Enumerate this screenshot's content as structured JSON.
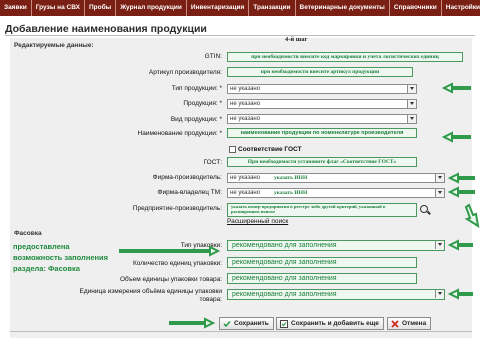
{
  "menu": {
    "items": [
      "Заявки",
      "Грузы на СВХ",
      "Пробы",
      "Журнал продукции",
      "Инвентаризация",
      "Транзакции",
      "Ветеринарные документы",
      "Справочники",
      "Настройки"
    ]
  },
  "page_title": "Добавление наименования продукции",
  "step_label": "4-й шаг",
  "sections": {
    "editable": "Редактируемые данные:",
    "packaging": "Фасовка"
  },
  "fields": {
    "gtin": {
      "label": "GTIN:",
      "hint": "при необходимости внесите код маркировки и учета логистических единиц"
    },
    "article": {
      "label": "Артикул производителя:",
      "hint": "при необходимости внесите артикул продукции"
    },
    "product_type": {
      "label": "Тип продукции: *",
      "value": "не указано"
    },
    "product": {
      "label": "Продукция: *",
      "value": "не указано"
    },
    "product_kind": {
      "label": "Вид продукции: *",
      "value": "не указано"
    },
    "product_name": {
      "label": "Наименование продукции: *",
      "hint": "наименование продукции по номенклатуре производителя"
    },
    "gost_checkbox": {
      "label": "Соответствие ГОСТ"
    },
    "gost": {
      "label": "ГОСТ:",
      "hint": "При необходимости установите флаг «Соответствие ГОСТ»"
    },
    "manufacturer": {
      "label": "Фирма-производитель:",
      "value": "не указано",
      "hint": "указать ИНН"
    },
    "tm_owner": {
      "label": "Фирма-владелец ТМ:",
      "value": "не указано",
      "hint": "указать ИНН"
    },
    "enterprise": {
      "label": "Предприятие-производитель:",
      "hint": "указать номер предприятия в реестре либо другой критерий, указанный в расширенном поиске"
    },
    "advanced_search": "Расширенный поиск"
  },
  "packaging": {
    "side_note": "предоставлена возможность заполнения раздела: Фасовка",
    "package_type": {
      "label": "Тип упаковки:",
      "hint": "рекомендовано для заполнения"
    },
    "package_count": {
      "label": "Количество единиц упаковки:",
      "hint": "рекомендовано для заполнения"
    },
    "package_volume": {
      "label": "Объем единицы упаковки товара:",
      "hint": "рекомендовано для заполнения"
    },
    "volume_unit": {
      "label": "Единица измерения объёма единицы упаковки товара:",
      "hint": "рекомендовано для заполнения"
    }
  },
  "buttons": {
    "save": "Сохранить",
    "save_add": "Сохранить и добавить еще",
    "cancel": "Отмена"
  },
  "colors": {
    "menu_bg": "#7a1f14",
    "hint_green": "#1b7f3b",
    "arrow_green": "#2f9a4a",
    "panel_bg": "#efefef"
  },
  "icons": {
    "magnifier": "magnifier-icon",
    "save": "save-icon",
    "save_add": "save-add-icon",
    "cancel": "cancel-icon"
  }
}
